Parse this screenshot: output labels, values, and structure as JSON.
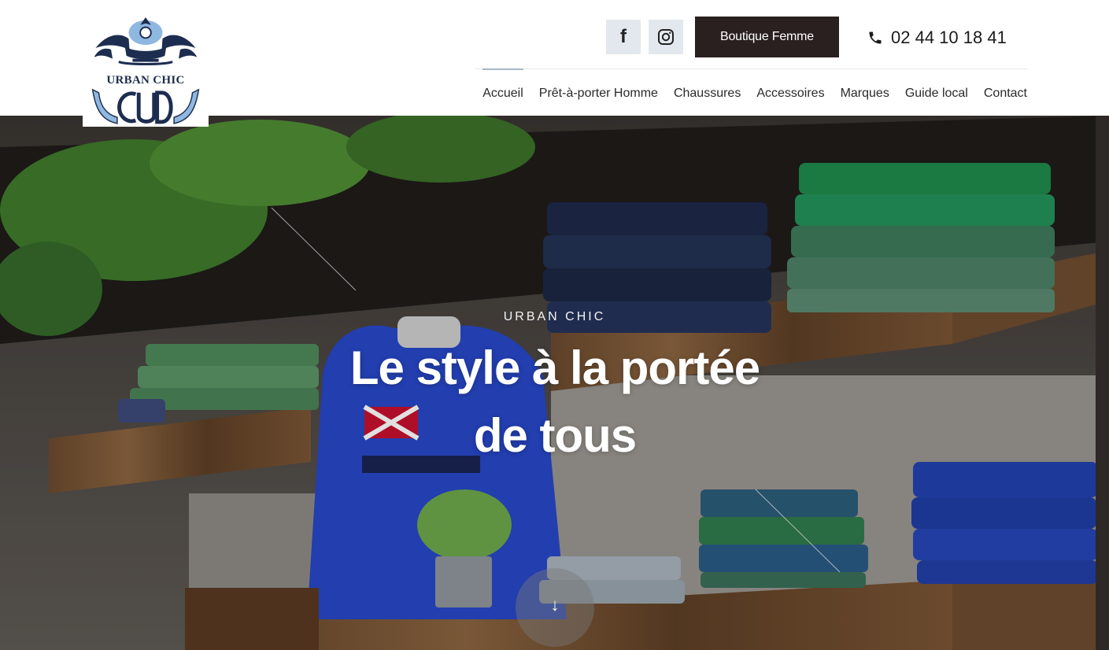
{
  "brand": {
    "logo_text": "URBAN CHIC",
    "logo_monogram": "CUD"
  },
  "header": {
    "social": [
      {
        "name": "facebook",
        "icon": "facebook-icon",
        "glyph": "f"
      },
      {
        "name": "instagram",
        "icon": "instagram-icon"
      }
    ],
    "cta_label": "Boutique Femme",
    "phone": "02 44 10 18 41",
    "phone_icon": "phone-icon"
  },
  "nav": {
    "items": [
      {
        "label": "Accueil",
        "active": true
      },
      {
        "label": "Prêt-à-porter Homme",
        "active": false
      },
      {
        "label": "Chaussures",
        "active": false
      },
      {
        "label": "Accessoires",
        "active": false
      },
      {
        "label": "Marques",
        "active": false
      },
      {
        "label": "Guide local",
        "active": false
      },
      {
        "label": "Contact",
        "active": false
      }
    ]
  },
  "hero": {
    "kicker": "URBAN CHIC",
    "title": "Le style à la portée de tous",
    "scroll_icon": "arrow-down-icon",
    "scroll_glyph": "↓"
  },
  "colors": {
    "cta_bg": "#2a2020",
    "social_bg": "#e3e8ee",
    "active_indicator": "#a9b6c8",
    "logo_navy": "#1d2d4f",
    "logo_light_blue": "#8fb8e0"
  }
}
